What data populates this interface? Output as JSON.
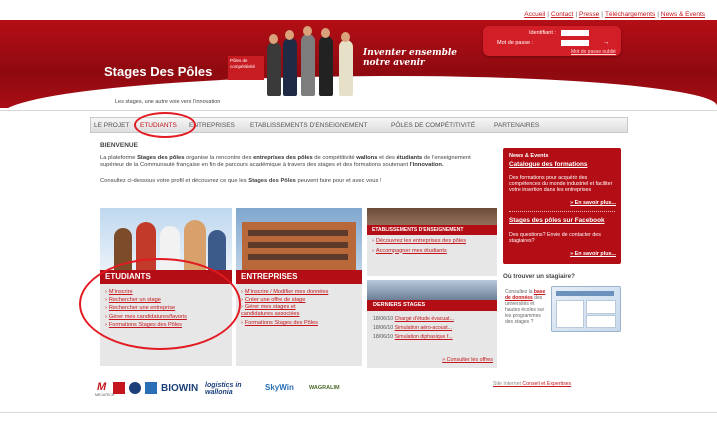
{
  "toplinks": [
    {
      "label": "Accueil"
    },
    {
      "label": "Contact"
    },
    {
      "label": "Presse"
    },
    {
      "label": "Téléchargements"
    },
    {
      "label": "News & Events"
    }
  ],
  "header": {
    "brand": "Stages Des Pôles",
    "badge": "Pôles de compétitivité",
    "tagline": "Les stages, une autre voie vers l'innovation",
    "slogan_line1": "Inventer ensemble",
    "slogan_line2": "notre avenir"
  },
  "login": {
    "id_label": "Identifiant :",
    "pwd_label": "Mot de passe :",
    "forgot": "Mot de passe oublié",
    "go": "→"
  },
  "nav": {
    "items": [
      "LE PROJET",
      "ETUDIANTS",
      "ENTREPRISES",
      "ETABLISSEMENTS D'ENSEIGNEMENT",
      "PÔLES DE COMPÉTITIVITÉ",
      "PARTENAIRES"
    ]
  },
  "main": {
    "title": "BIENVENUE",
    "intro_a": "La plateforme ",
    "intro_b": "Stages des pôles",
    "intro_c": " organise la rencontre des ",
    "intro_d": "entreprises des pôles",
    "intro_e": " de compétitivité ",
    "intro_f": "wallons",
    "intro_g": " et des ",
    "intro_h": "étudiants",
    "intro_i": " de l'enseignement supérieur de la Communauté française en fin de parcours académique à travers des stages et des formations soutenant ",
    "intro_j": "l'innovation.",
    "intro2_a": "Consultez ci-dessous votre profil et découvrez ce que les ",
    "intro2_b": "Stages des Pôles",
    "intro2_c": " peuvent faire pour et avec vous !"
  },
  "cards": {
    "etudiants": {
      "title": "ETUDIANTS",
      "links": [
        "M'inscrire",
        "Rechercher un stage",
        "Rechercher une entreprise",
        "Gérer mes candidatures/favoris",
        "Formations Stages des Pôles"
      ]
    },
    "entreprises": {
      "title": "ENTREPRISES",
      "links": [
        "M'inscrire / Modifier mes données",
        "Créer une offre de stage",
        "Gérer mes stages et candidatures associées",
        "Formations Stages des Pôles"
      ]
    },
    "etablissements": {
      "title": "ETABLISSEMENTS D'ENSEIGNEMENT",
      "links": [
        "Découvrez les entreprises des pôles",
        "Accompagner mes étudiants"
      ]
    }
  },
  "derniers": {
    "title": "DERNIERS STAGES",
    "rows": [
      {
        "date": "18/06/10",
        "text": "Chargé d'étude évacuat..."
      },
      {
        "date": "18/06/10",
        "text": "Simulation aéro-acoust..."
      },
      {
        "date": "18/06/10",
        "text": "Simulation diphasique f..."
      }
    ],
    "more": "» Consulter les offres"
  },
  "news": {
    "heading": "News & Events",
    "item1_title": "Catalogue des formations",
    "item1_text": "Des formations pour acquérir des compétences du monde industriel et faciliter votre insertion dans les entreprises",
    "more": "» En savoir plus...",
    "item2_title": "Stages des pôles sur Facebook",
    "item2_text": "Des questions? Envie de contacter des stagiaires?"
  },
  "where": {
    "heading": "Où trouver un stagiaire?",
    "text_a": "Consultez la ",
    "text_link": "base de données",
    "text_b": " des universités et hautes écoles sur les programmes des stages ?"
  },
  "partners": [
    "MECATECH",
    "BIOWIN",
    "logistics in wallonia",
    "SkyWin",
    "WAGRALIM"
  ],
  "footer_link_a": "Site Internet ",
  "footer_link_b": "Conseil et Expertises",
  "colors": {
    "brand_red": "#b30e15",
    "link_red": "#c4161c"
  }
}
